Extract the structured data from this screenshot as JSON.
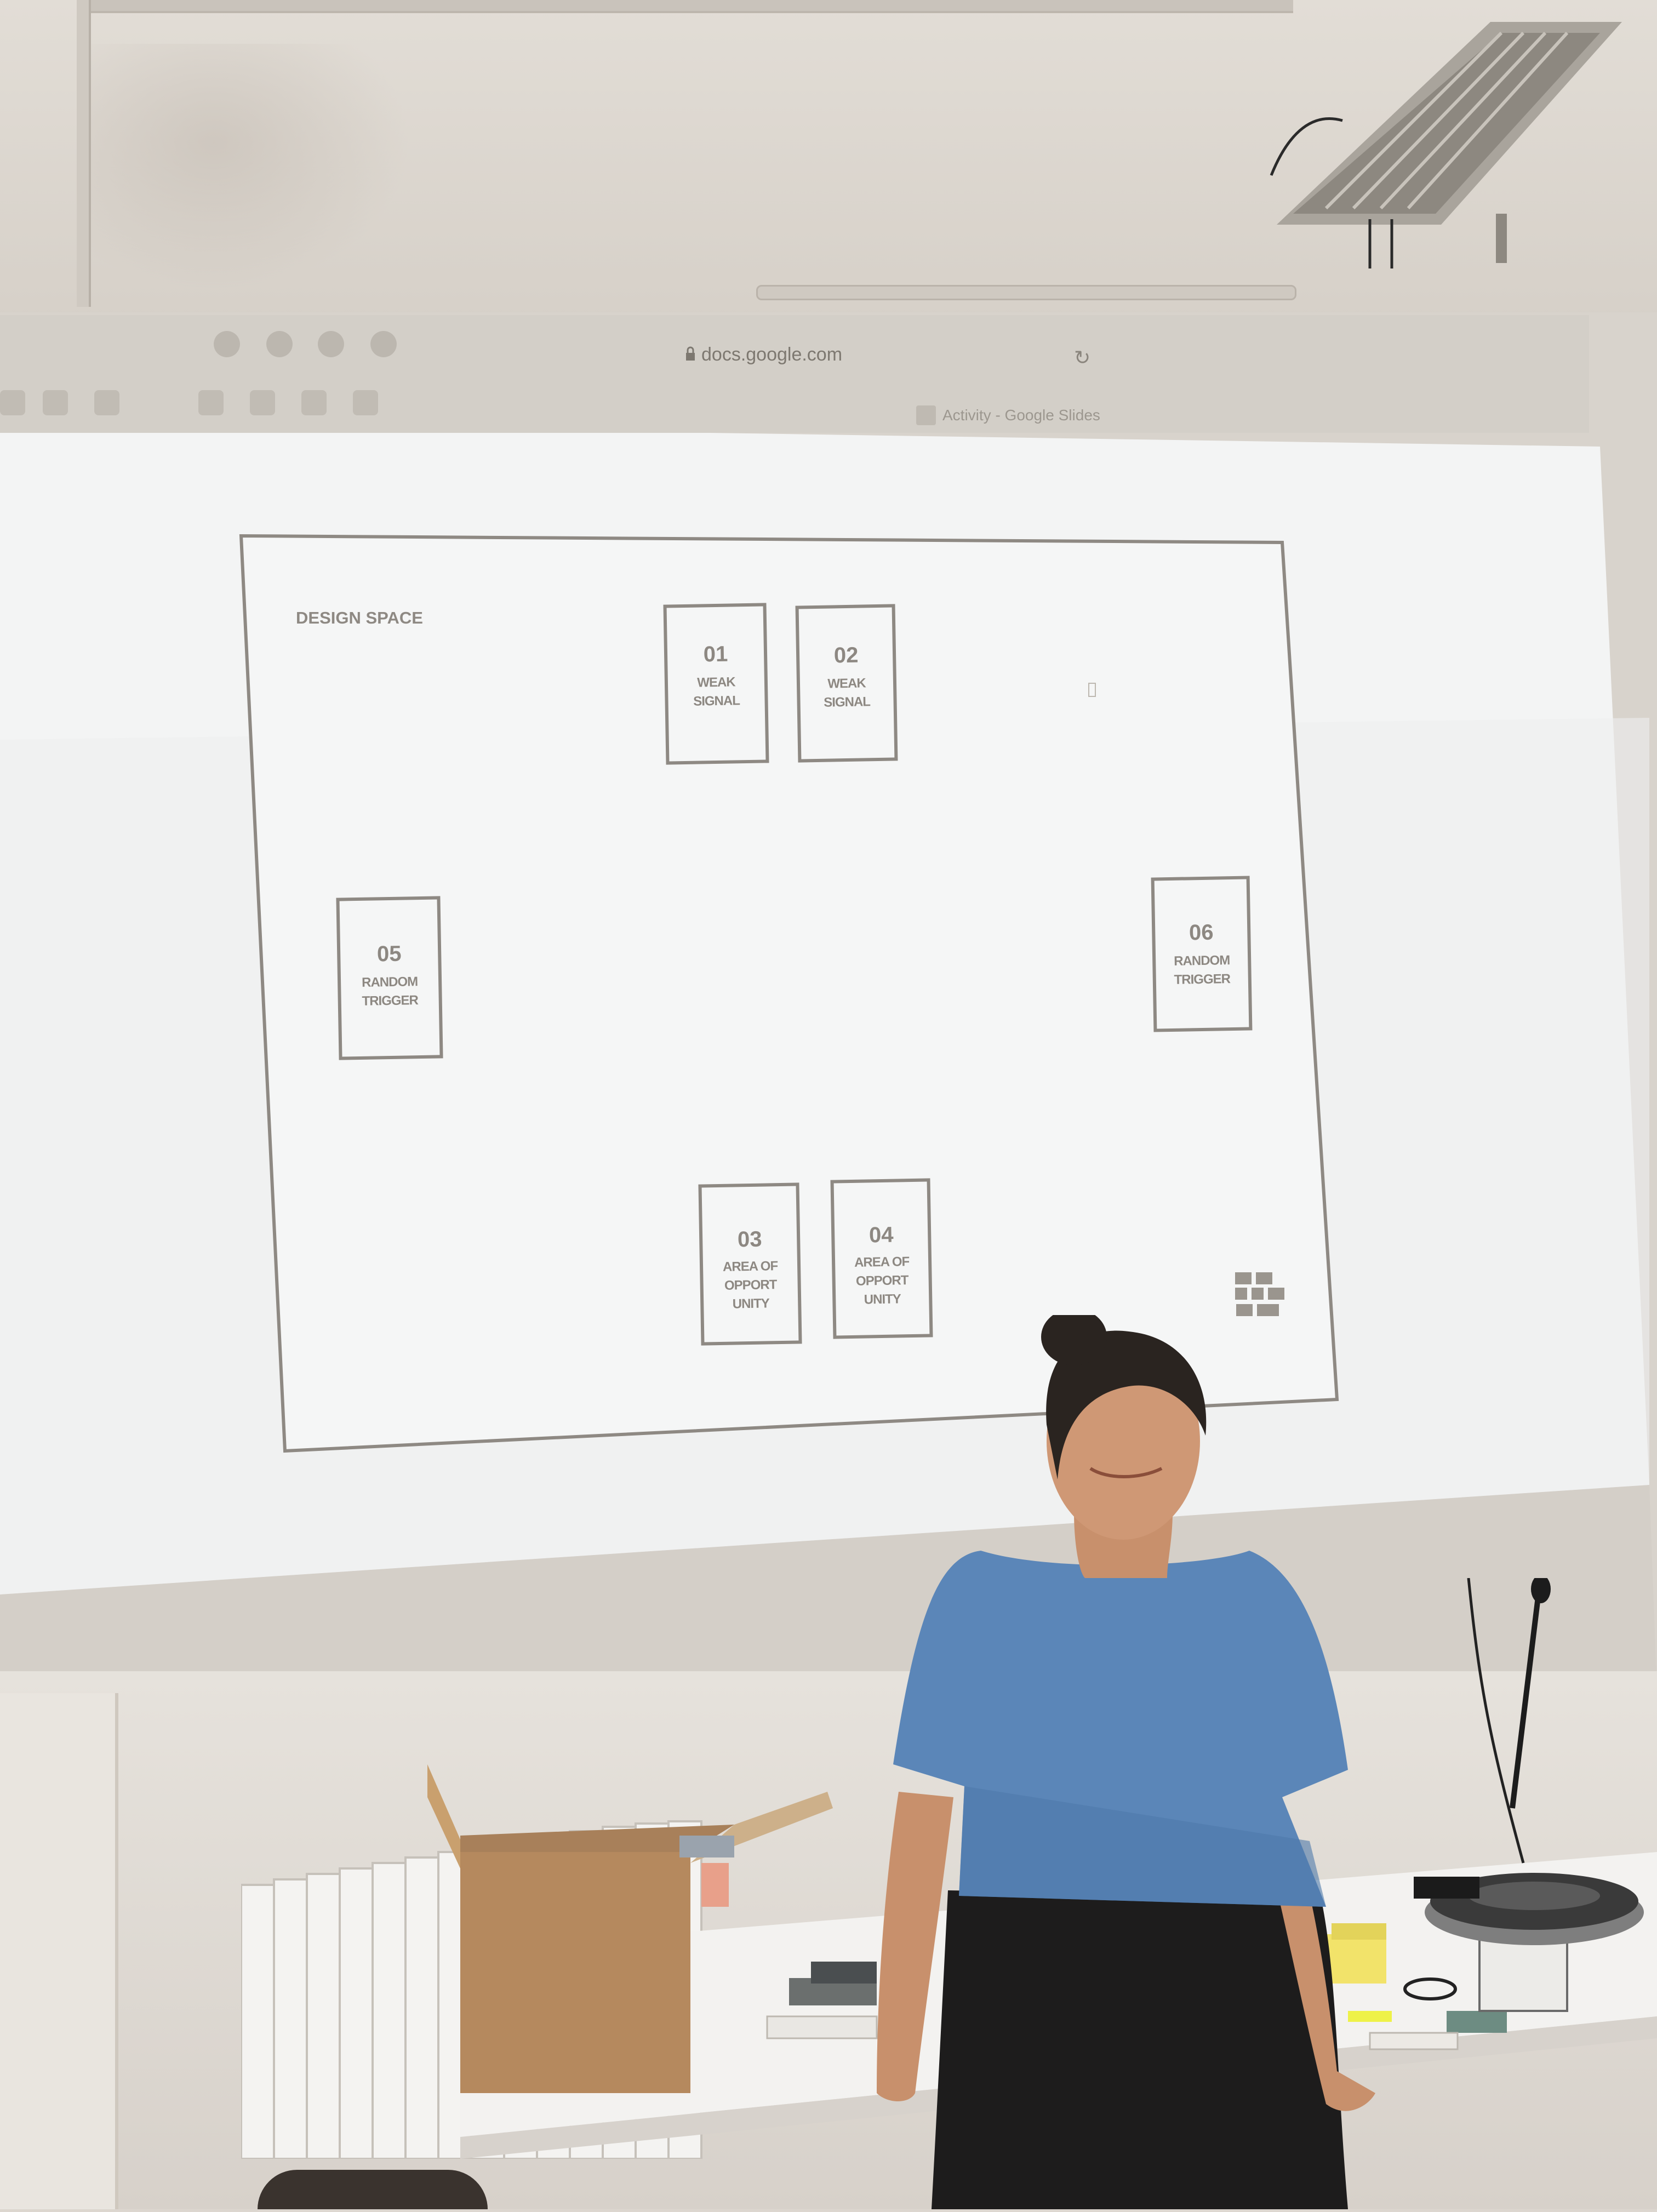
{
  "browser": {
    "url": "docs.google.com",
    "tab_title": "Activity - Google Slides"
  },
  "slide": {
    "heading": "DESIGN SPACE",
    "cards": [
      {
        "number": "01",
        "label_line1": "WEAK",
        "label_line2": "SIGNAL",
        "label_line3": ""
      },
      {
        "number": "02",
        "label_line1": "WEAK",
        "label_line2": "SIGNAL",
        "label_line3": ""
      },
      {
        "number": "03",
        "label_line1": "AREA OF",
        "label_line2": "OPPORT",
        "label_line3": "UNITY"
      },
      {
        "number": "04",
        "label_line1": "AREA OF",
        "label_line2": "OPPORT",
        "label_line3": "UNITY"
      },
      {
        "number": "05",
        "label_line1": "RANDOM",
        "label_line2": "TRIGGER",
        "label_line3": ""
      },
      {
        "number": "06",
        "label_line1": "RANDOM",
        "label_line2": "TRIGGER",
        "label_line3": ""
      }
    ]
  },
  "colors": {
    "slide_background": "#f1f2f2",
    "slide_text": "#8d8882",
    "shirt": "#5b86b8",
    "trousers": "#1d1c1c",
    "hair": "#2a2420",
    "box": "#b58a60"
  },
  "icons": [
    "lock-icon",
    "reload-icon",
    "slides-favicon-icon",
    "logo-mark-icon"
  ]
}
